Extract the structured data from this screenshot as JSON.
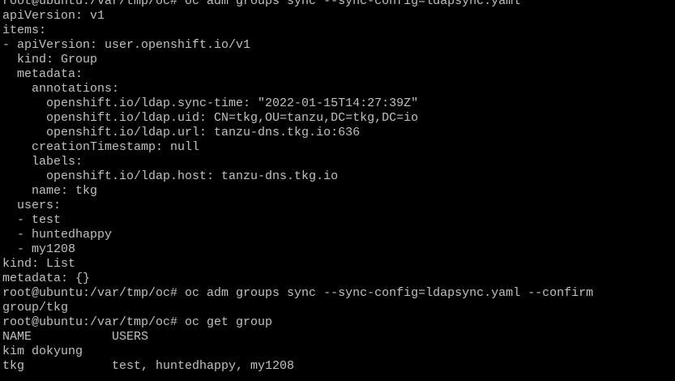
{
  "terminal": {
    "foreground_color": "#c0c0c0",
    "background_color": "#000000",
    "lines": [
      "root@ubuntu:/var/tmp/oc# oc adm groups sync --sync-config=ldapsync.yaml",
      "apiVersion: v1",
      "items:",
      "- apiVersion: user.openshift.io/v1",
      "  kind: Group",
      "  metadata:",
      "    annotations:",
      "      openshift.io/ldap.sync-time: \"2022-01-15T14:27:39Z\"",
      "      openshift.io/ldap.uid: CN=tkg,OU=tanzu,DC=tkg,DC=io",
      "      openshift.io/ldap.url: tanzu-dns.tkg.io:636",
      "    creationTimestamp: null",
      "    labels:",
      "      openshift.io/ldap.host: tanzu-dns.tkg.io",
      "    name: tkg",
      "  users:",
      "  - test",
      "  - huntedhappy",
      "  - my1208",
      "kind: List",
      "metadata: {}",
      "root@ubuntu:/var/tmp/oc# oc adm groups sync --sync-config=ldapsync.yaml --confirm",
      "group/tkg",
      "root@ubuntu:/var/tmp/oc# oc get group",
      "NAME           USERS",
      "kim dokyung",
      "tkg            test, huntedhappy, my1208"
    ]
  }
}
